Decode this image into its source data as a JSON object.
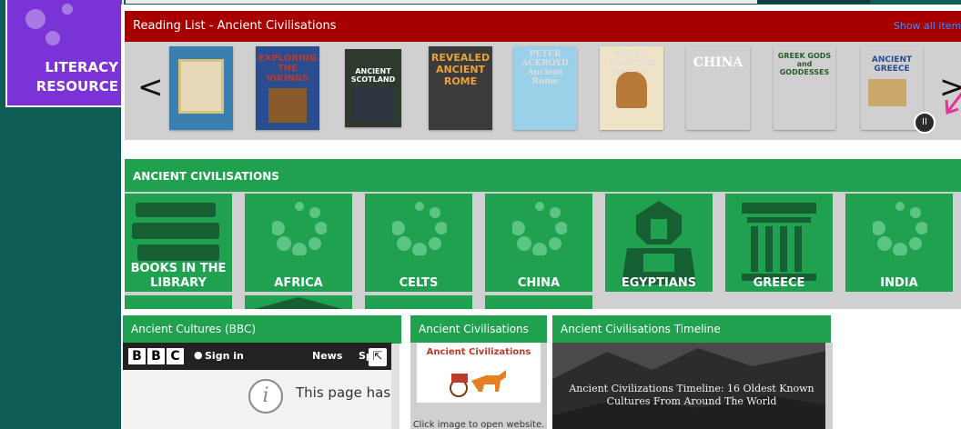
{
  "background_tile": {
    "label_line1": "LITERACY",
    "label_line2": "RESOURCE"
  },
  "reading_list": {
    "title": "Reading List - Ancient Civilisations",
    "show_all": "Show all items",
    "prev_arrow": "<",
    "next_arrow": ">",
    "pause_glyph": "II",
    "books": [
      {
        "title": "",
        "bg": "#3b7fb0"
      },
      {
        "title": "EXPLORING THE VIKINGS",
        "bg": "#e8d9b8"
      },
      {
        "title": "ANCIENT SCOTLAND",
        "bg": "#2a4d8f"
      },
      {
        "title": "REVEALED ANCIENT ROME",
        "bg": "#8a5a2b"
      },
      {
        "title": "PETER ACKROYD Ancient Rome",
        "bg": "#2e3a2e"
      },
      {
        "title": "PETER ACKROYD Ancient Greece",
        "bg": "#2c3440"
      },
      {
        "title": "CHINA",
        "bg": "#3b3b3b"
      },
      {
        "title": "GREEK GODS and GODDESSES",
        "bg": "#9ad0e8"
      },
      {
        "title": "ANCIENT GREECE",
        "bg": "#efe3c6"
      }
    ]
  },
  "ancient_civilisations": {
    "header": "ANCIENT CIVILISATIONS",
    "tiles": [
      {
        "label_line1": "BOOKS IN THE",
        "label_line2": "LIBRARY",
        "icon": "books-icon"
      },
      {
        "label_line1": "AFRICA",
        "label_line2": "",
        "icon": "spinner-icon"
      },
      {
        "label_line1": "CELTS",
        "label_line2": "",
        "icon": "spinner-icon"
      },
      {
        "label_line1": "CHINA",
        "label_line2": "",
        "icon": "spinner-icon"
      },
      {
        "label_line1": "EGYPTIANS",
        "label_line2": "",
        "icon": "sphinx-icon"
      },
      {
        "label_line1": "GREECE",
        "label_line2": "",
        "icon": "temple-icon"
      },
      {
        "label_line1": "INDIA",
        "label_line2": "",
        "icon": "spinner-icon"
      }
    ]
  },
  "widgets": {
    "bbc": {
      "header": "Ancient Cultures (BBC)",
      "logo": [
        "B",
        "B",
        "C"
      ],
      "sign_in": "Sign in",
      "news": "News",
      "sport_partial": "Sp",
      "message": "This page has"
    },
    "ancient_civs": {
      "header": "Ancient Civilisations",
      "card_title": "Ancient Civilizations",
      "caption": "Click image to open website."
    },
    "timeline": {
      "header": "Ancient Civilisations Timeline",
      "image_title_line1": "Ancient Civilizations Timeline: 16 Oldest Known",
      "image_title_line2": "Cultures From Around The World"
    }
  }
}
